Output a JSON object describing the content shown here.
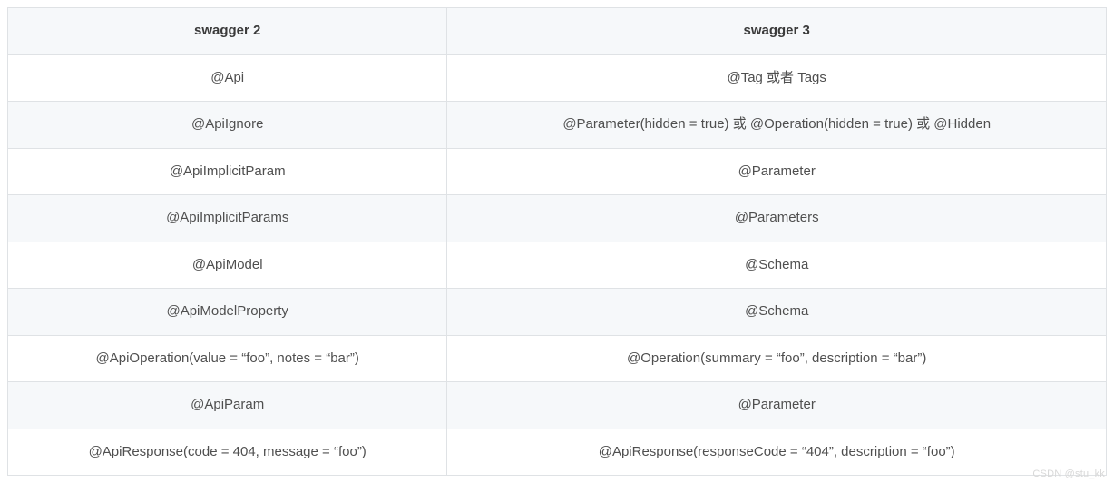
{
  "table": {
    "headers": [
      "swagger 2",
      "swagger 3"
    ],
    "rows": [
      {
        "c0": "@Api",
        "c1": "@Tag 或者 Tags"
      },
      {
        "c0": "@ApiIgnore",
        "c1": "@Parameter(hidden = true) 或 @Operation(hidden = true) 或 @Hidden"
      },
      {
        "c0": "@ApiImplicitParam",
        "c1": "@Parameter"
      },
      {
        "c0": "@ApiImplicitParams",
        "c1": "@Parameters"
      },
      {
        "c0": "@ApiModel",
        "c1": "@Schema"
      },
      {
        "c0": "@ApiModelProperty",
        "c1": "@Schema"
      },
      {
        "c0": "@ApiOperation(value = “foo”, notes = “bar”)",
        "c1": "@Operation(summary = “foo”, description = “bar”)"
      },
      {
        "c0": "@ApiParam",
        "c1": "@Parameter"
      },
      {
        "c0": "@ApiResponse(code = 404, message = “foo”)",
        "c1": "@ApiResponse(responseCode = “404”, description = “foo”)"
      }
    ]
  },
  "watermark": "CSDN @stu_kk"
}
